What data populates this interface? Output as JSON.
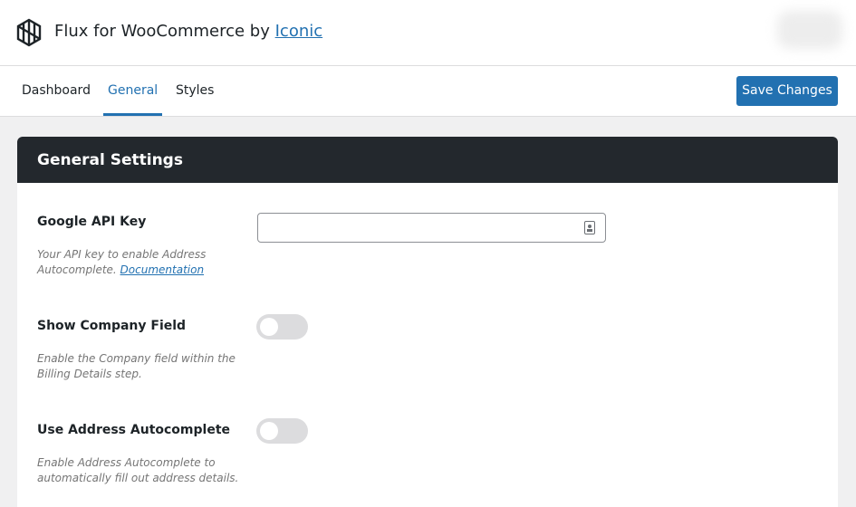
{
  "header": {
    "title_prefix": "Flux for WooCommerce by ",
    "title_link": "Iconic"
  },
  "nav": {
    "tabs": [
      {
        "label": "Dashboard",
        "active": false
      },
      {
        "label": "General",
        "active": true
      },
      {
        "label": "Styles",
        "active": false
      }
    ],
    "save_label": "Save Changes"
  },
  "card": {
    "title": "General Settings",
    "settings": [
      {
        "label": "Google API Key",
        "description": "Your API key to enable Address Autocomplete. ",
        "link": "Documentation",
        "value": ""
      },
      {
        "label": "Show Company Field",
        "description": "Enable the Company field within the Billing Details step.",
        "enabled": false
      },
      {
        "label": "Use Address Autocomplete",
        "description": "Enable Address Autocomplete to automatically fill out address details.",
        "enabled": false
      }
    ]
  },
  "colors": {
    "accent": "#2271b1",
    "header_dark": "#23282d",
    "background": "#f0f0f1"
  }
}
